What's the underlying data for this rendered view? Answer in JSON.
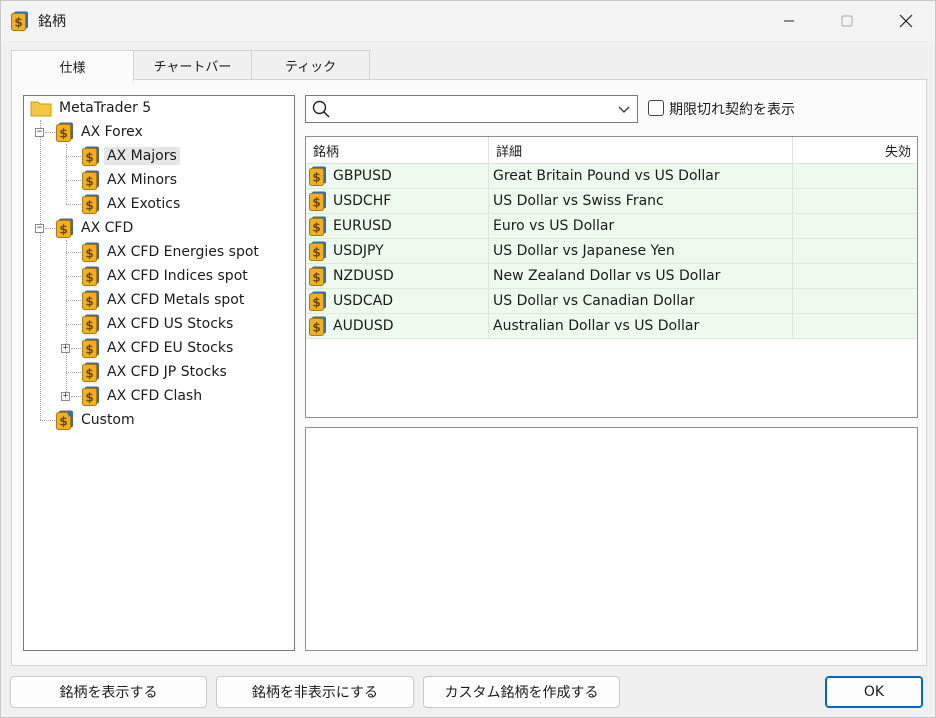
{
  "window": {
    "title": "銘柄",
    "accent": "#0067c0"
  },
  "tabs": [
    {
      "label": "仕様",
      "active": true
    },
    {
      "label": "チャートバー",
      "active": false
    },
    {
      "label": "ティック",
      "active": false
    }
  ],
  "tree": {
    "root": "MetaTrader 5",
    "forex": {
      "label": "AX Forex",
      "children": [
        "AX Majors",
        "AX Minors",
        "AX Exotics"
      ],
      "selected": "AX Majors"
    },
    "cfd": {
      "label": "AX CFD",
      "children": [
        "AX CFD Energies spot",
        "AX CFD Indices spot",
        "AX CFD Metals spot",
        "AX CFD US Stocks",
        "AX CFD EU Stocks",
        "AX CFD JP Stocks",
        "AX CFD Clash"
      ]
    },
    "custom": "Custom"
  },
  "search": {
    "value": "",
    "icon": "search-icon"
  },
  "filter": {
    "show_expired_label": "期限切れ契約を表示",
    "checked": false
  },
  "table": {
    "columns": [
      "銘柄",
      "詳細",
      "失効"
    ],
    "rows": [
      {
        "symbol": "GBPUSD",
        "description": "Great Britain Pound vs US Dollar",
        "expiry": ""
      },
      {
        "symbol": "USDCHF",
        "description": "US Dollar vs Swiss Franc",
        "expiry": ""
      },
      {
        "symbol": "EURUSD",
        "description": "Euro vs US Dollar",
        "expiry": ""
      },
      {
        "symbol": "USDJPY",
        "description": "US Dollar vs Japanese Yen",
        "expiry": ""
      },
      {
        "symbol": "NZDUSD",
        "description": "New Zealand Dollar vs US Dollar",
        "expiry": ""
      },
      {
        "symbol": "USDCAD",
        "description": "US Dollar vs Canadian Dollar",
        "expiry": ""
      },
      {
        "symbol": "AUDUSD",
        "description": "Australian Dollar vs US Dollar",
        "expiry": ""
      }
    ],
    "row_color": "#edfaed"
  },
  "buttons": {
    "show": "銘柄を表示する",
    "hide": "銘柄を非表示にする",
    "create_custom": "カスタム銘柄を作成する",
    "ok": "OK"
  }
}
